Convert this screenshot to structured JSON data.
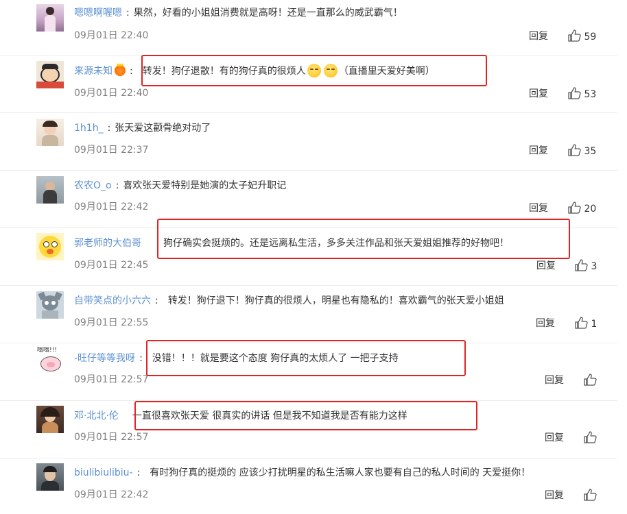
{
  "colors": {
    "username": "#5b8fd2",
    "highlight_box": "#e02424",
    "time": "#808080"
  },
  "reply_label": "回复",
  "like_icon": "thumbs-up-icon",
  "comments": [
    {
      "user": "嗯嗯啊喔嗯",
      "badge": "",
      "text_a": "果然，好看的小姐姐消费就是高呀！还是一直那么的威武霸气！",
      "text_b": "",
      "time": "09月01日 22:40",
      "likes": "59"
    },
    {
      "user": "来源未知",
      "badge": "crown-badge-icon",
      "text_a": "转发！狗仔退散！有的狗仔真的很烦人",
      "text_b": "（直播里天爱好美啊）",
      "time": "09月01日 22:40",
      "likes": "53"
    },
    {
      "user": "1h1h_",
      "badge": "",
      "text_a": "张天爱这颧骨绝对动了",
      "text_b": "",
      "time": "09月01日 22:37",
      "likes": "35"
    },
    {
      "user": "农农O_o",
      "badge": "",
      "text_a": "喜欢张天爱特别是她演的太子妃升职记",
      "text_b": "",
      "time": "09月01日 22:42",
      "likes": "20"
    },
    {
      "user": "郭老师的大伯哥",
      "badge": "",
      "text_a": "狗仔确实会挺烦的。还是远离私生活，多多关注作品和张天爱姐姐推荐的好物吧！",
      "text_b": "",
      "time": "09月01日 22:45",
      "likes": "3"
    },
    {
      "user": "自带笑点的小六六",
      "badge": "",
      "text_a": "转发！狗仔退下！狗仔真的很烦人，明星也有隐私的！喜欢霸气的张天爱小姐姐",
      "text_b": "",
      "time": "09月01日 22:55",
      "likes": "1"
    },
    {
      "user": "-旺仔等等我呀",
      "badge": "",
      "text_a": "没错！！！就是要这个态度 狗仔真的太烦人了 一把子支持",
      "text_b": "",
      "time": "09月01日 22:57",
      "likes": ""
    },
    {
      "user": "邓·北北·伦",
      "badge": "",
      "text_a": "一直很喜欢张天爱 很真实的讲话 但是我不知道我是否有能力这样",
      "text_b": "",
      "time": "09月01日 22:57",
      "likes": ""
    },
    {
      "user": "biulibiulibiu-",
      "badge": "",
      "text_a": "有时狗仔真的挺烦的 应该少打扰明星的私生活嘛人家也要有自己的私人时间的 天爱挺你！",
      "text_b": "",
      "time": "09月01日 22:42",
      "likes": ""
    }
  ]
}
